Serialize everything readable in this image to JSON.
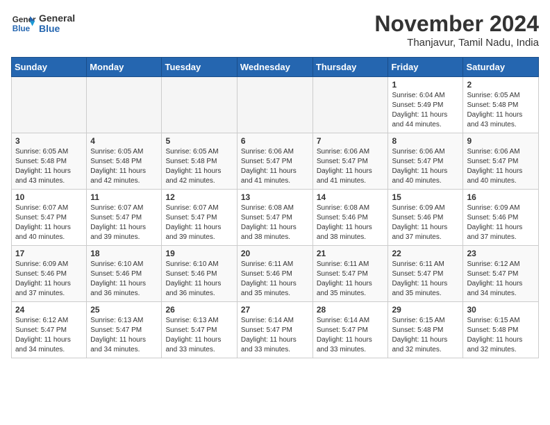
{
  "header": {
    "logo_general": "General",
    "logo_blue": "Blue",
    "month_year": "November 2024",
    "location": "Thanjavur, Tamil Nadu, India"
  },
  "weekdays": [
    "Sunday",
    "Monday",
    "Tuesday",
    "Wednesday",
    "Thursday",
    "Friday",
    "Saturday"
  ],
  "weeks": [
    [
      {
        "day": "",
        "info": ""
      },
      {
        "day": "",
        "info": ""
      },
      {
        "day": "",
        "info": ""
      },
      {
        "day": "",
        "info": ""
      },
      {
        "day": "",
        "info": ""
      },
      {
        "day": "1",
        "info": "Sunrise: 6:04 AM\nSunset: 5:49 PM\nDaylight: 11 hours and 44 minutes."
      },
      {
        "day": "2",
        "info": "Sunrise: 6:05 AM\nSunset: 5:48 PM\nDaylight: 11 hours and 43 minutes."
      }
    ],
    [
      {
        "day": "3",
        "info": "Sunrise: 6:05 AM\nSunset: 5:48 PM\nDaylight: 11 hours and 43 minutes."
      },
      {
        "day": "4",
        "info": "Sunrise: 6:05 AM\nSunset: 5:48 PM\nDaylight: 11 hours and 42 minutes."
      },
      {
        "day": "5",
        "info": "Sunrise: 6:05 AM\nSunset: 5:48 PM\nDaylight: 11 hours and 42 minutes."
      },
      {
        "day": "6",
        "info": "Sunrise: 6:06 AM\nSunset: 5:47 PM\nDaylight: 11 hours and 41 minutes."
      },
      {
        "day": "7",
        "info": "Sunrise: 6:06 AM\nSunset: 5:47 PM\nDaylight: 11 hours and 41 minutes."
      },
      {
        "day": "8",
        "info": "Sunrise: 6:06 AM\nSunset: 5:47 PM\nDaylight: 11 hours and 40 minutes."
      },
      {
        "day": "9",
        "info": "Sunrise: 6:06 AM\nSunset: 5:47 PM\nDaylight: 11 hours and 40 minutes."
      }
    ],
    [
      {
        "day": "10",
        "info": "Sunrise: 6:07 AM\nSunset: 5:47 PM\nDaylight: 11 hours and 40 minutes."
      },
      {
        "day": "11",
        "info": "Sunrise: 6:07 AM\nSunset: 5:47 PM\nDaylight: 11 hours and 39 minutes."
      },
      {
        "day": "12",
        "info": "Sunrise: 6:07 AM\nSunset: 5:47 PM\nDaylight: 11 hours and 39 minutes."
      },
      {
        "day": "13",
        "info": "Sunrise: 6:08 AM\nSunset: 5:47 PM\nDaylight: 11 hours and 38 minutes."
      },
      {
        "day": "14",
        "info": "Sunrise: 6:08 AM\nSunset: 5:46 PM\nDaylight: 11 hours and 38 minutes."
      },
      {
        "day": "15",
        "info": "Sunrise: 6:09 AM\nSunset: 5:46 PM\nDaylight: 11 hours and 37 minutes."
      },
      {
        "day": "16",
        "info": "Sunrise: 6:09 AM\nSunset: 5:46 PM\nDaylight: 11 hours and 37 minutes."
      }
    ],
    [
      {
        "day": "17",
        "info": "Sunrise: 6:09 AM\nSunset: 5:46 PM\nDaylight: 11 hours and 37 minutes."
      },
      {
        "day": "18",
        "info": "Sunrise: 6:10 AM\nSunset: 5:46 PM\nDaylight: 11 hours and 36 minutes."
      },
      {
        "day": "19",
        "info": "Sunrise: 6:10 AM\nSunset: 5:46 PM\nDaylight: 11 hours and 36 minutes."
      },
      {
        "day": "20",
        "info": "Sunrise: 6:11 AM\nSunset: 5:46 PM\nDaylight: 11 hours and 35 minutes."
      },
      {
        "day": "21",
        "info": "Sunrise: 6:11 AM\nSunset: 5:47 PM\nDaylight: 11 hours and 35 minutes."
      },
      {
        "day": "22",
        "info": "Sunrise: 6:11 AM\nSunset: 5:47 PM\nDaylight: 11 hours and 35 minutes."
      },
      {
        "day": "23",
        "info": "Sunrise: 6:12 AM\nSunset: 5:47 PM\nDaylight: 11 hours and 34 minutes."
      }
    ],
    [
      {
        "day": "24",
        "info": "Sunrise: 6:12 AM\nSunset: 5:47 PM\nDaylight: 11 hours and 34 minutes."
      },
      {
        "day": "25",
        "info": "Sunrise: 6:13 AM\nSunset: 5:47 PM\nDaylight: 11 hours and 34 minutes."
      },
      {
        "day": "26",
        "info": "Sunrise: 6:13 AM\nSunset: 5:47 PM\nDaylight: 11 hours and 33 minutes."
      },
      {
        "day": "27",
        "info": "Sunrise: 6:14 AM\nSunset: 5:47 PM\nDaylight: 11 hours and 33 minutes."
      },
      {
        "day": "28",
        "info": "Sunrise: 6:14 AM\nSunset: 5:47 PM\nDaylight: 11 hours and 33 minutes."
      },
      {
        "day": "29",
        "info": "Sunrise: 6:15 AM\nSunset: 5:48 PM\nDaylight: 11 hours and 32 minutes."
      },
      {
        "day": "30",
        "info": "Sunrise: 6:15 AM\nSunset: 5:48 PM\nDaylight: 11 hours and 32 minutes."
      }
    ]
  ]
}
